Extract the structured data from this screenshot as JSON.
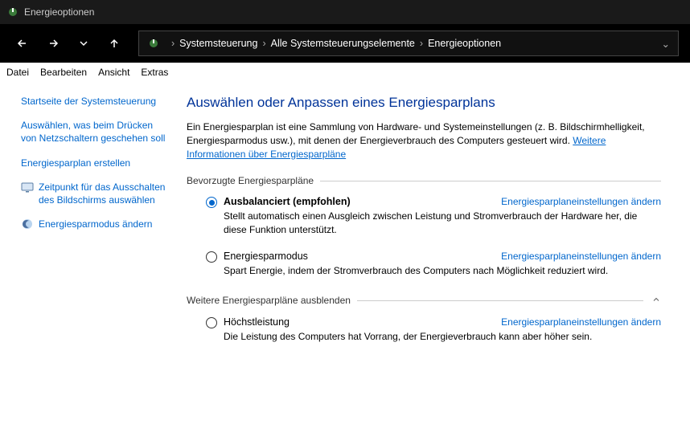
{
  "titlebar": {
    "title": "Energieoptionen"
  },
  "breadcrumb": {
    "items": [
      "Systemsteuerung",
      "Alle Systemsteuerungselemente",
      "Energieoptionen"
    ]
  },
  "menubar": {
    "items": [
      "Datei",
      "Bearbeiten",
      "Ansicht",
      "Extras"
    ]
  },
  "sidebar": {
    "home": "Startseite der Systemsteuerung",
    "link1": "Auswählen, was beim Drücken von Netzschaltern geschehen soll",
    "link2": "Energiesparplan erstellen",
    "link3": "Zeitpunkt für das Ausschalten des Bildschirms auswählen",
    "link4": "Energiesparmodus ändern"
  },
  "main": {
    "title": "Auswählen oder Anpassen eines Energiesparplans",
    "desc": "Ein Energiesparplan ist eine Sammlung von Hardware- und Systemeinstellungen (z. B. Bildschirmhelligkeit, Energiesparmodus usw.), mit denen der Energieverbrauch des Computers gesteuert wird. ",
    "moreinfo": "Weitere Informationen über Energiesparpläne",
    "group1": {
      "label": "Bevorzugte Energiesparpläne"
    },
    "group2": {
      "label": "Weitere Energiesparpläne ausblenden"
    },
    "plans": {
      "balanced": {
        "name": "Ausbalanciert (empfohlen)",
        "change": "Energiesparplaneinstellungen ändern",
        "desc": "Stellt automatisch einen Ausgleich zwischen Leistung und Stromverbrauch der Hardware her, die diese Funktion unterstützt."
      },
      "saver": {
        "name": "Energiesparmodus",
        "change": "Energiesparplaneinstellungen ändern",
        "desc": "Spart Energie, indem der Stromverbrauch des Computers nach Möglichkeit reduziert wird."
      },
      "high": {
        "name": "Höchstleistung",
        "change": "Energiesparplaneinstellungen ändern",
        "desc": "Die Leistung des Computers hat Vorrang, der Energieverbrauch kann aber höher sein."
      }
    }
  }
}
